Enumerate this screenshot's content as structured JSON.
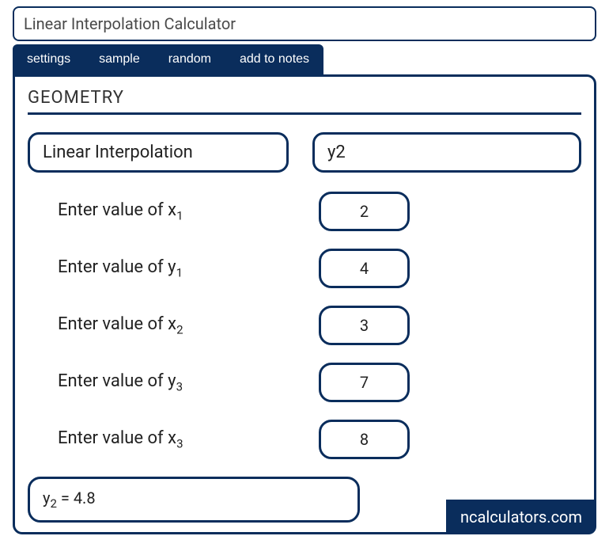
{
  "title": "Linear Interpolation Calculator",
  "tabs": {
    "settings": "settings",
    "sample": "sample",
    "random": "random",
    "add_to_notes": "add to notes"
  },
  "section_title": "GEOMETRY",
  "header": {
    "method": "Linear Interpolation",
    "target": "y2"
  },
  "inputs": [
    {
      "label_prefix": "Enter value of x",
      "label_sub": "1",
      "value": "2"
    },
    {
      "label_prefix": "Enter value of y",
      "label_sub": "1",
      "value": "4"
    },
    {
      "label_prefix": "Enter value of x",
      "label_sub": "2",
      "value": "3"
    },
    {
      "label_prefix": "Enter value of y",
      "label_sub": "3",
      "value": "7"
    },
    {
      "label_prefix": "Enter value of x",
      "label_sub": "3",
      "value": "8"
    }
  ],
  "result": {
    "var_prefix": "y",
    "var_sub": "2",
    "joiner": "  =  ",
    "value": "4.8"
  },
  "brand": "ncalculators.com"
}
